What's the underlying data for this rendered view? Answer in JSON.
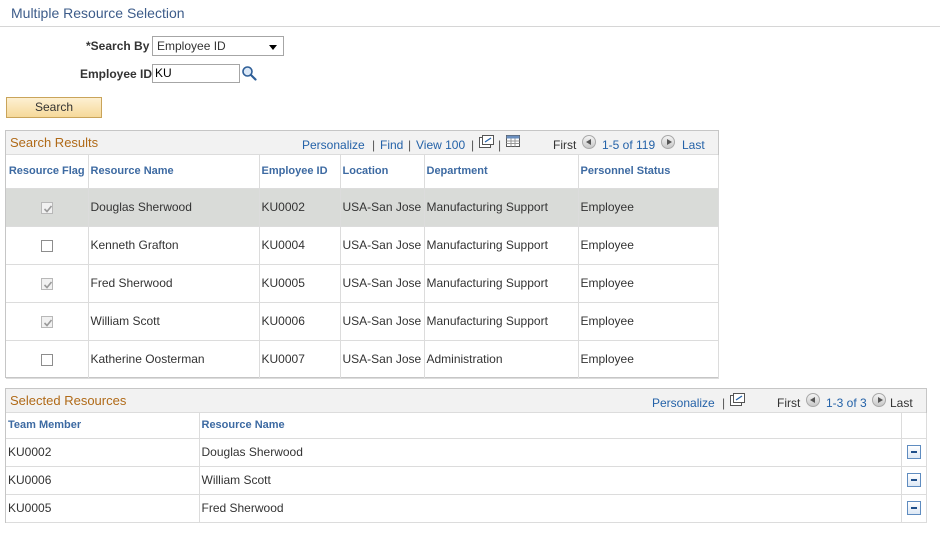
{
  "page": {
    "title": "Multiple Resource Selection"
  },
  "form": {
    "search_by_label": "*Search By",
    "search_by_value": "Employee ID",
    "employee_id_label": "Employee ID",
    "employee_id_value": "KU",
    "search_button": "Search"
  },
  "search_results": {
    "title": "Search Results",
    "nav": {
      "personalize": "Personalize",
      "find": "Find",
      "view100": "View 100",
      "first": "First",
      "range": "1-5 of 119",
      "last": "Last"
    },
    "columns": [
      "Resource Flag",
      "Resource Name",
      "Employee ID",
      "Location",
      "Department",
      "Personnel Status"
    ],
    "rows": [
      {
        "flag": "checked-disabled",
        "name": "Douglas Sherwood",
        "id": "KU0002",
        "location": "USA-San Jose",
        "department": "Manufacturing Support",
        "status": "Employee"
      },
      {
        "flag": "unchecked",
        "name": "Kenneth Grafton",
        "id": "KU0004",
        "location": "USA-San Jose",
        "department": "Manufacturing Support",
        "status": "Employee"
      },
      {
        "flag": "checked-disabled",
        "name": "Fred Sherwood",
        "id": "KU0005",
        "location": "USA-San Jose",
        "department": "Manufacturing Support",
        "status": "Employee"
      },
      {
        "flag": "checked-disabled",
        "name": "William Scott",
        "id": "KU0006",
        "location": "USA-San Jose",
        "department": "Manufacturing Support",
        "status": "Employee"
      },
      {
        "flag": "unchecked",
        "name": "Katherine Oosterman",
        "id": "KU0007",
        "location": "USA-San Jose",
        "department": "Administration",
        "status": "Employee"
      }
    ]
  },
  "selected_resources": {
    "title": "Selected Resources",
    "nav": {
      "personalize": "Personalize",
      "first": "First",
      "range": "1-3 of 3",
      "last": "Last"
    },
    "columns": [
      "Team Member",
      "Resource Name"
    ],
    "rows": [
      {
        "member": "KU0002",
        "name": "Douglas Sherwood"
      },
      {
        "member": "KU0006",
        "name": "William Scott"
      },
      {
        "member": "KU0005",
        "name": "Fred Sherwood"
      }
    ]
  },
  "icons": [
    "search-icon",
    "zoom-grid-icon",
    "download-icon",
    "nav-prev-icon",
    "nav-next-icon",
    "delete-row-icon"
  ],
  "colors": {
    "title_blue": "#3d5c8a",
    "grid_title_orange": "#b06a18",
    "link_blue": "#2462a8",
    "selected_row": "#d9dbd8"
  }
}
